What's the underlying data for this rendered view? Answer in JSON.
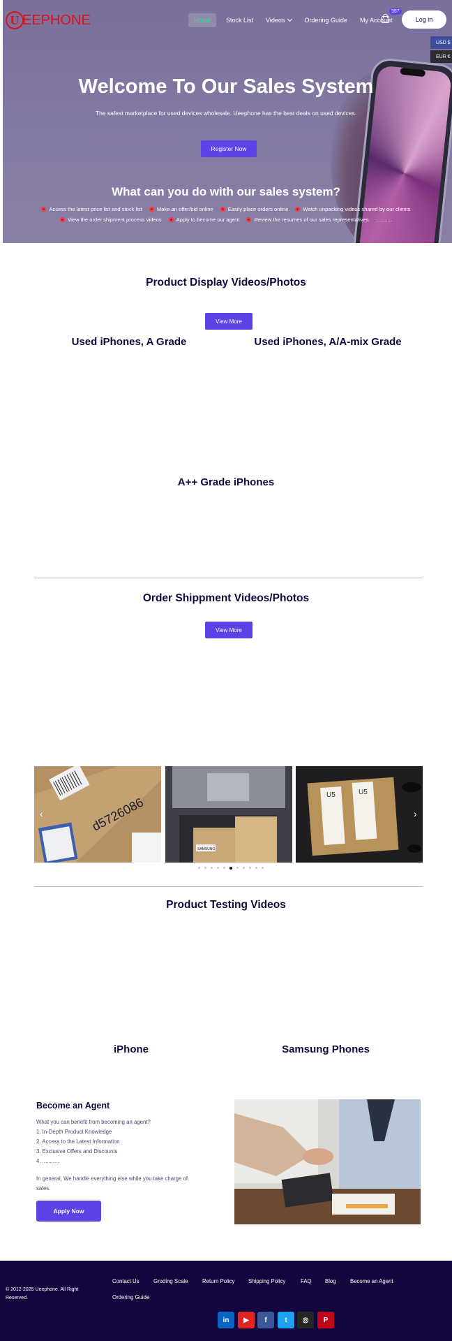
{
  "brand": {
    "logo_letter": "U",
    "logo_text": "EEPHONE",
    "color": "#d3161c"
  },
  "nav": {
    "items": [
      {
        "label": "Home",
        "active": true
      },
      {
        "label": "Stock List"
      },
      {
        "label": "Videos",
        "has_dropdown": true
      },
      {
        "label": "Ordering Guide"
      },
      {
        "label": "My Account"
      }
    ],
    "cart_count": "357",
    "login_label": "Log in"
  },
  "currency": {
    "usd": "USD $",
    "eur": "EUR €"
  },
  "hero": {
    "title": "Welcome To Our Sales System",
    "subtitle": "The safest marketplace for used devices wholesale. Ueephone has the best deals on used devices.",
    "register_label": "Register Now",
    "features_title": "What can you do with our sales system?",
    "features_row1": [
      "Access the latest price list and stock list",
      "Make an offer/bid online",
      "Easily place orders online",
      "Watch unpacking videos shared by our clients"
    ],
    "features_row2": [
      "View the order shipment process videos",
      "Apply to become our agent",
      "Review the resumes of our sales representatives"
    ],
    "features_more": "..........."
  },
  "product_display": {
    "title": "Product Display Videos/Photos",
    "button": "View More",
    "col1": "Used iPhones, A Grade",
    "col2": "Used iPhones, A/A-mix Grade",
    "center": "A++ Grade iPhones"
  },
  "shipment": {
    "title": "Order Shippment Videos/Photos",
    "button": "View More",
    "slide_count": 11,
    "active_slide": 5,
    "box1_code": "d5726086",
    "box2_label": "SAMSUNG",
    "box3_labels": [
      "U5",
      "U5"
    ]
  },
  "testing": {
    "title": "Product Testing Videos",
    "col1": "iPhone",
    "col2": "Samsung Phones"
  },
  "agent": {
    "title": "Become an Agent",
    "lines": [
      "What you can benefit from becoming an agent?",
      "1. In-Depth Product Knowledge",
      "2. Access to the Latest Information",
      "3. Exclusive Offers and Discounts",
      "4. ..........."
    ],
    "summary_1": "In general, We handle everything else while you take charge of",
    "summary_2": "sales.",
    "button": "Apply Now"
  },
  "footer": {
    "copyright": "© 2012-2025 Ueephone. All Right Reserved.",
    "links_row1": [
      "Contact Us",
      "Groding Scale",
      "Return Policy",
      "Shipping Policy",
      "FAQ",
      "Blog",
      "Become an Agent"
    ],
    "links_row2": [
      "Ordering Guide"
    ],
    "social": [
      {
        "name": "linkedin-icon",
        "glyph": "in",
        "color": "#0a66c2"
      },
      {
        "name": "youtube-icon",
        "glyph": "▶",
        "color": "#e02424"
      },
      {
        "name": "facebook-icon",
        "glyph": "f",
        "color": "#3b5998"
      },
      {
        "name": "twitter-icon",
        "glyph": "t",
        "color": "#1da1f2"
      },
      {
        "name": "instagram-icon",
        "glyph": "◎",
        "color": "#262626"
      },
      {
        "name": "pinterest-icon",
        "glyph": "P",
        "color": "#bd081c"
      }
    ]
  }
}
